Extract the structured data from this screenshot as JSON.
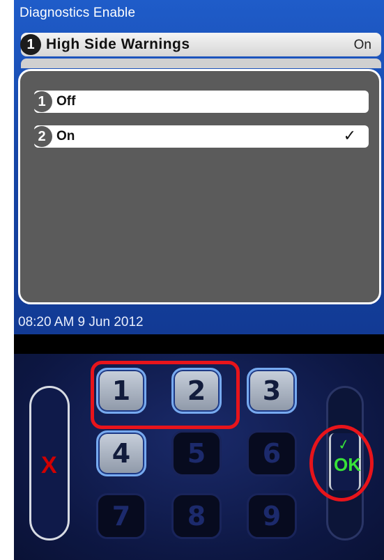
{
  "screen": {
    "title": "Diagnostics Enable",
    "menu": {
      "number": "1",
      "label": "High Side Warnings",
      "value": "On"
    },
    "popup": {
      "options": [
        {
          "number": "1",
          "label": "Off",
          "checked": false
        },
        {
          "number": "2",
          "label": "On",
          "checked": true,
          "check_glyph": "✓"
        }
      ]
    },
    "status_time": "08:20 AM 9 Jun 2012"
  },
  "keypad": {
    "cancel_label": "X",
    "ok_label": "OK",
    "ok_check_glyph": "✓",
    "keys": [
      {
        "label": "1",
        "enabled": true
      },
      {
        "label": "2",
        "enabled": true
      },
      {
        "label": "3",
        "enabled": true
      },
      {
        "label": "4",
        "enabled": true
      },
      {
        "label": "5",
        "enabled": false
      },
      {
        "label": "6",
        "enabled": false
      },
      {
        "label": "7",
        "enabled": false
      },
      {
        "label": "8",
        "enabled": false
      },
      {
        "label": "9",
        "enabled": false
      }
    ]
  },
  "colors": {
    "screen_blue": "#1646a8",
    "popup_gray": "#5b5b5b",
    "highlight_red": "#e8141b",
    "ok_green": "#38e238",
    "cancel_red": "#d00000"
  }
}
